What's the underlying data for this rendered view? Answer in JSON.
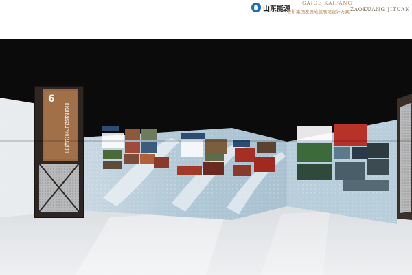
{
  "header": {
    "brand": "山东能源",
    "subtitle_en_1": "GAIGE KAIFANG",
    "title_cn": "枣矿集团发展成就展馆设计方案",
    "subtitle_en_2": "ZAOKUANG JITUAN",
    "logo_icon": "shandong-energy-logo-icon"
  },
  "exhibit": {
    "section_number": "6",
    "section_title": "民生福祉与国企担当"
  },
  "colors": {
    "ceiling": "#0b0b0b",
    "wall": "#b7ccd9",
    "wall_light": "#dfe8ee",
    "floor": "#e6e8ea",
    "pillar_frame": "#2d2622",
    "pillar_panel": "#9a6840",
    "accent_brand": "#1e6fb8",
    "header_text": "#b5885a"
  }
}
